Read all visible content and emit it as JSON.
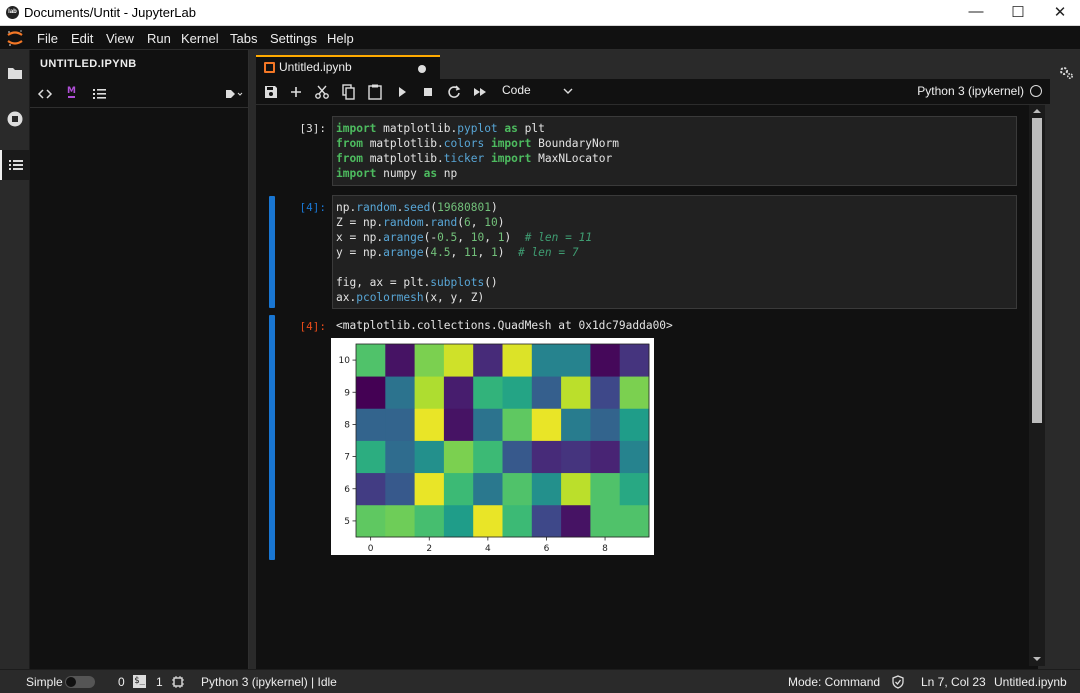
{
  "window": {
    "title": "Documents/Untit - JupyterLab",
    "logo_text": "lab"
  },
  "menu": [
    "File",
    "Edit",
    "View",
    "Run",
    "Kernel",
    "Tabs",
    "Settings",
    "Help"
  ],
  "toc": {
    "header": "UNTITLED.IPYNB"
  },
  "tab": {
    "name": "Untitled.ipynb"
  },
  "toolbar": {
    "cell_type": "Code",
    "kernel": "Python 3 (ipykernel)"
  },
  "cells": {
    "c3": {
      "prompt": "[3]:",
      "lines": [
        [
          [
            "kw",
            "import"
          ],
          [
            "t",
            " matplotlib."
          ],
          [
            "fn",
            "pyplot"
          ],
          [
            "t",
            " "
          ],
          [
            "kw",
            "as"
          ],
          [
            "t",
            " plt"
          ]
        ],
        [
          [
            "kw",
            "from"
          ],
          [
            "t",
            " matplotlib."
          ],
          [
            "fn",
            "colors"
          ],
          [
            "t",
            " "
          ],
          [
            "kw",
            "import"
          ],
          [
            "t",
            " BoundaryNorm"
          ]
        ],
        [
          [
            "kw",
            "from"
          ],
          [
            "t",
            " matplotlib."
          ],
          [
            "fn",
            "ticker"
          ],
          [
            "t",
            " "
          ],
          [
            "kw",
            "import"
          ],
          [
            "t",
            " MaxNLocator"
          ]
        ],
        [
          [
            "kw",
            "import"
          ],
          [
            "t",
            " numpy "
          ],
          [
            "kw",
            "as"
          ],
          [
            "t",
            " np"
          ]
        ]
      ]
    },
    "c4": {
      "prompt": "[4]:",
      "lines": [
        [
          [
            "t",
            "np."
          ],
          [
            "fn",
            "random"
          ],
          [
            "t",
            "."
          ],
          [
            "fn",
            "seed"
          ],
          [
            "t",
            "("
          ],
          [
            "num",
            "19680801"
          ],
          [
            "t",
            ")"
          ]
        ],
        [
          [
            "t",
            "Z = np."
          ],
          [
            "fn",
            "random"
          ],
          [
            "t",
            "."
          ],
          [
            "fn",
            "rand"
          ],
          [
            "t",
            "("
          ],
          [
            "num",
            "6"
          ],
          [
            "t",
            ", "
          ],
          [
            "num",
            "10"
          ],
          [
            "t",
            ")"
          ]
        ],
        [
          [
            "t",
            "x = np."
          ],
          [
            "fn",
            "arange"
          ],
          [
            "t",
            "(-"
          ],
          [
            "num",
            "0.5"
          ],
          [
            "t",
            ", "
          ],
          [
            "num",
            "10"
          ],
          [
            "t",
            ", "
          ],
          [
            "num",
            "1"
          ],
          [
            "t",
            ")  "
          ],
          [
            "cm",
            "# len = 11"
          ]
        ],
        [
          [
            "t",
            "y = np."
          ],
          [
            "fn",
            "arange"
          ],
          [
            "t",
            "("
          ],
          [
            "num",
            "4.5"
          ],
          [
            "t",
            ", "
          ],
          [
            "num",
            "11"
          ],
          [
            "t",
            ", "
          ],
          [
            "num",
            "1"
          ],
          [
            "t",
            ")  "
          ],
          [
            "cm",
            "# len = 7"
          ]
        ],
        [
          [
            "t",
            ""
          ]
        ],
        [
          [
            "t",
            "fig, ax = plt."
          ],
          [
            "fn",
            "subplots"
          ],
          [
            "t",
            "()"
          ]
        ],
        [
          [
            "t",
            "ax."
          ],
          [
            "fn",
            "pcolormesh"
          ],
          [
            "t",
            "(x, y, Z)"
          ]
        ]
      ]
    },
    "out4": {
      "prompt": "[4]:",
      "text": "<matplotlib.collections.QuadMesh at 0x1dc79adda00>"
    }
  },
  "chart_data": {
    "type": "heatmap",
    "x_edges": [
      -0.5,
      0.5,
      1.5,
      2.5,
      3.5,
      4.5,
      5.5,
      6.5,
      7.5,
      8.5,
      9.5
    ],
    "y_edges": [
      4.5,
      5.5,
      6.5,
      7.5,
      8.5,
      9.5,
      10.5
    ],
    "xticks": [
      0,
      2,
      4,
      6,
      8
    ],
    "yticks": [
      5,
      6,
      7,
      8,
      9,
      10
    ],
    "xlim": [
      -0.5,
      9.5
    ],
    "ylim": [
      4.5,
      10.5
    ],
    "colormap": "viridis",
    "rows_bottom_to_top": [
      [
        0.75,
        0.78,
        0.7,
        0.55,
        0.97,
        0.68,
        0.22,
        0.05,
        0.72,
        0.72
      ],
      [
        0.18,
        0.28,
        0.97,
        0.68,
        0.4,
        0.72,
        0.5,
        0.9,
        0.72,
        0.6
      ],
      [
        0.62,
        0.35,
        0.5,
        0.8,
        0.68,
        0.28,
        0.12,
        0.15,
        0.1,
        0.45
      ],
      [
        0.32,
        0.32,
        0.97,
        0.05,
        0.38,
        0.75,
        0.97,
        0.42,
        0.32,
        0.55
      ],
      [
        0.0,
        0.38,
        0.88,
        0.08,
        0.65,
        0.58,
        0.3,
        0.9,
        0.22,
        0.8
      ],
      [
        0.72,
        0.05,
        0.8,
        0.93,
        0.12,
        0.95,
        0.45,
        0.45,
        0.02,
        0.15
      ]
    ]
  },
  "status": {
    "mode_toggle": "Simple",
    "terminals": "0",
    "kernels": "1",
    "kernel_status": "Python 3 (ipykernel) | Idle",
    "mode": "Mode: Command",
    "cursor": "Ln 7, Col 23",
    "file": "Untitled.ipynb"
  },
  "colors": {
    "accent": "#1976d2",
    "tab_top": "#ffaa00",
    "prompt_in": "#1976d2",
    "prompt_out": "#e64a19"
  }
}
